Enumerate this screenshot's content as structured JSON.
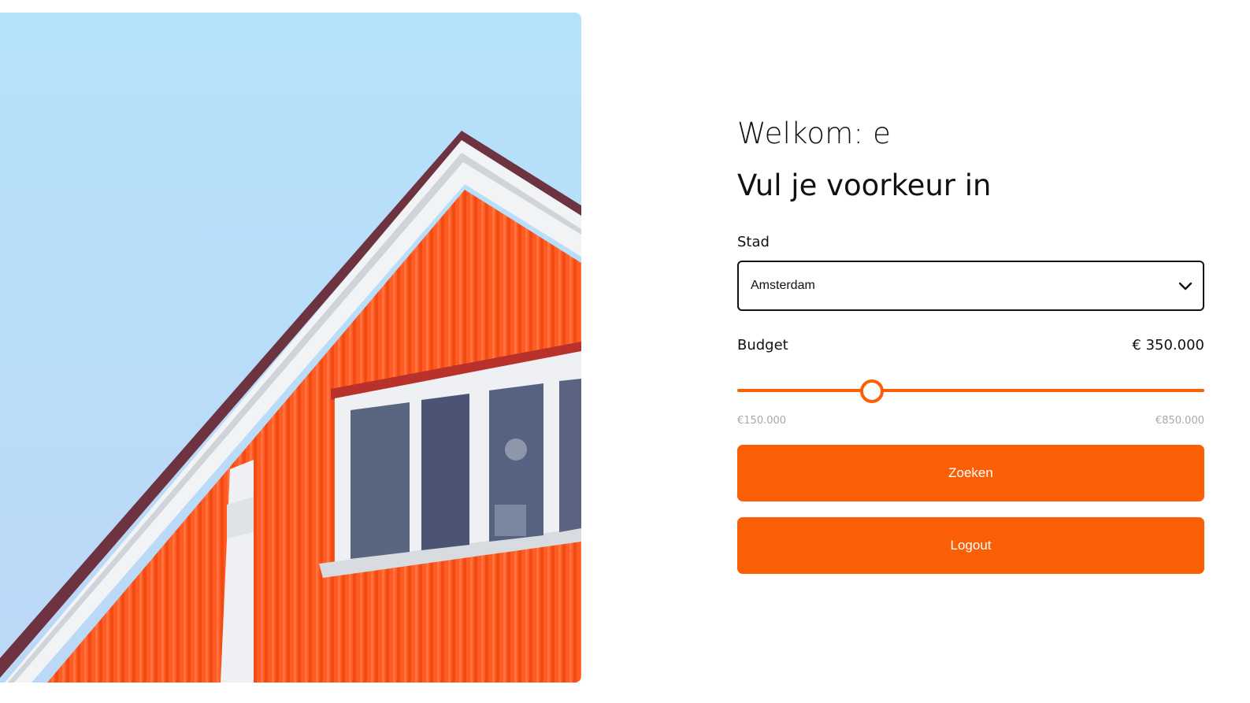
{
  "header": {
    "welcome": "Welkom: e",
    "title": "Vul je voorkeur in"
  },
  "form": {
    "city_label": "Stad",
    "city_value": "Amsterdam",
    "budget_label": "Budget",
    "budget_value": "€ 350.000",
    "budget_min": "€150.000",
    "budget_max": "€850.000",
    "budget_slider_fraction": 0.286
  },
  "buttons": {
    "search": "Zoeken",
    "logout": "Logout"
  },
  "colors": {
    "accent": "#fa5f06",
    "sky": "#b5e2fb",
    "house": "#ff5a1f"
  },
  "icons": {
    "select": "chevron-down-icon"
  }
}
